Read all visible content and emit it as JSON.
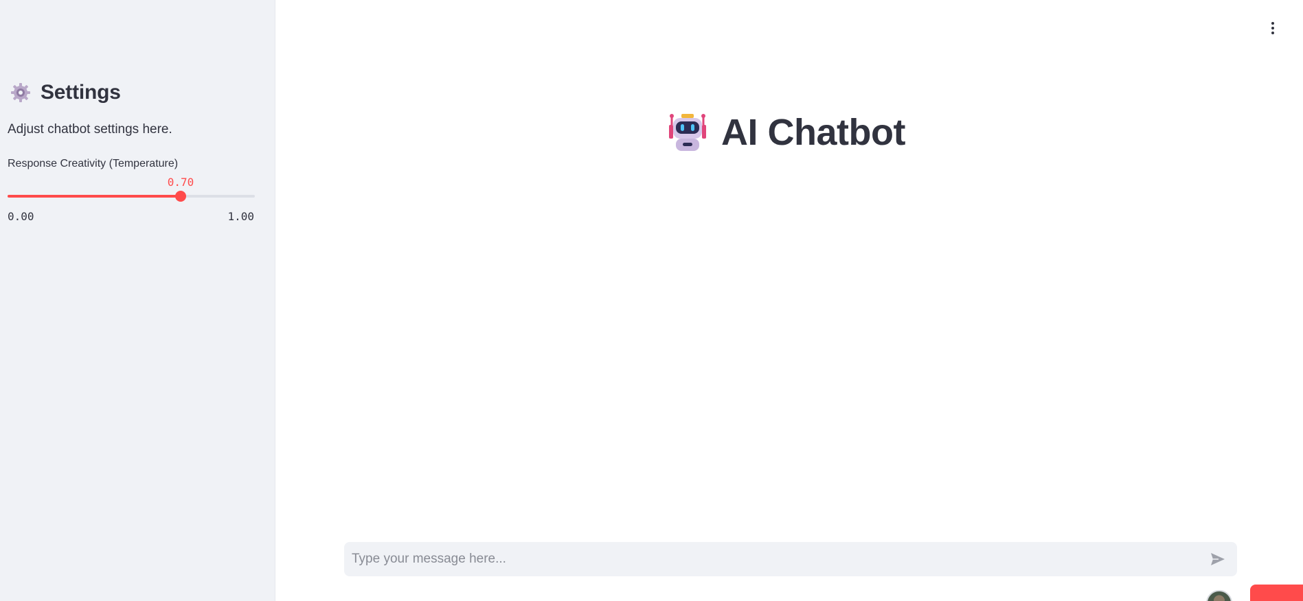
{
  "sidebar": {
    "title": "Settings",
    "title_icon": "gear-icon",
    "description": "Adjust chatbot settings here.",
    "slider": {
      "label": "Response Creativity (Temperature)",
      "value": 0.7,
      "value_text": "0.70",
      "min_text": "0.00",
      "max_text": "1.00",
      "min": 0.0,
      "max": 1.0
    }
  },
  "main": {
    "title": "AI Chatbot",
    "title_icon": "robot-icon",
    "menu_icon": "vertical-dots-icon"
  },
  "chat": {
    "placeholder": "Type your message here...",
    "send_icon": "send-icon"
  },
  "colors": {
    "accent": "#ff4b4b",
    "sidebar_bg": "#f0f2f6",
    "text": "#31333f"
  }
}
